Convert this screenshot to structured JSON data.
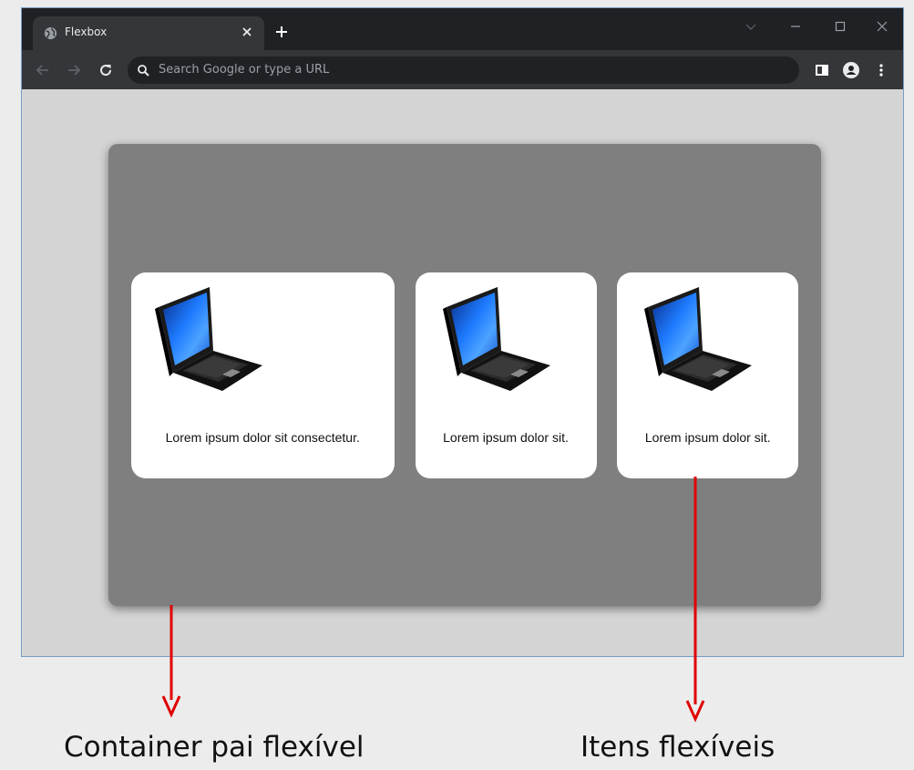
{
  "browser": {
    "tab_title": "Flexbox",
    "omnibox_placeholder": "Search Google or type a URL"
  },
  "cards": [
    {
      "text": "Lorem ipsum dolor sit consectetur."
    },
    {
      "text": "Lorem ipsum dolor sit."
    },
    {
      "text": "Lorem ipsum dolor sit."
    }
  ],
  "annotations": {
    "container_label": "Container pai flexível",
    "items_label": "Itens flexíveis"
  },
  "colors": {
    "arrow": "#e00000",
    "container_bg": "#7f7f7f",
    "card_bg": "#ffffff",
    "titlebar": "#202124",
    "toolbar": "#35363a"
  },
  "icons": {
    "tab": "globe-icon",
    "close": "close-icon",
    "new_tab": "plus-icon",
    "back": "arrow-left-icon",
    "forward": "arrow-right-icon",
    "reload": "reload-icon",
    "search": "search-icon",
    "side_panel": "side-panel-icon",
    "profile": "profile-icon",
    "menu": "kebab-menu-icon",
    "card_image": "laptop-icon"
  }
}
